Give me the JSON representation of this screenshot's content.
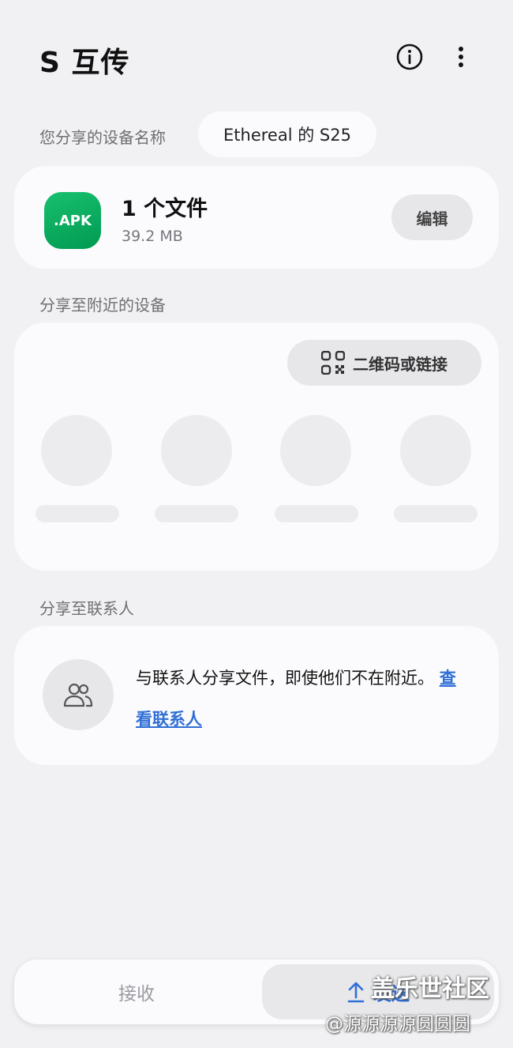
{
  "header": {
    "title": "S 互传",
    "info_icon": "info-circle-icon",
    "more_icon": "more-vert-icon"
  },
  "device_name": {
    "label": "您分享的设备名称",
    "value": "Ethereal 的 S25"
  },
  "file_card": {
    "icon_text": ".APK",
    "count": "1 个文件",
    "size": "39.2 MB",
    "edit_label": "编辑",
    "icon_color": "#0fb062"
  },
  "nearby": {
    "label": "分享至附近的设备",
    "qr_button_label": "二维码或链接",
    "qr_icon": "qr-code-icon"
  },
  "contacts": {
    "label": "分享至联系人",
    "avatar_icon": "people-icon",
    "text": "与联系人分享文件，即使他们不在附近。",
    "link": "查看联系人"
  },
  "bottom": {
    "receive_label": "接收",
    "send_label": "发送",
    "send_icon": "upload-arrow-icon",
    "accent_color": "#2f6fd6"
  },
  "watermark": {
    "line1": "盖乐世社区",
    "line2": "@源源源源圆圆圆"
  }
}
